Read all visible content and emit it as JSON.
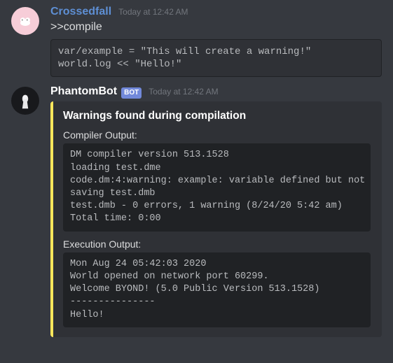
{
  "messages": [
    {
      "author": "Crossedfall",
      "author_color": "blue",
      "is_bot": false,
      "timestamp": "Today at 12:42 AM",
      "content": ">>compile",
      "code": "var/example = \"This will create a warning!\"\nworld.log << \"Hello!\""
    },
    {
      "author": "PhantomBot",
      "author_color": "white",
      "is_bot": true,
      "bot_label": "BOT",
      "timestamp": "Today at 12:42 AM",
      "embed": {
        "accent_color": "#ffe75c",
        "title": "Warnings found during compilation",
        "fields": [
          {
            "name": "Compiler Output:",
            "value": "DM compiler version 513.1528\nloading test.dme\ncode.dm:4:warning: example: variable defined but not used\nsaving test.dmb\ntest.dmb - 0 errors, 1 warning (8/24/20 5:42 am)\nTotal time: 0:00"
          },
          {
            "name": "Execution Output:",
            "value": "Mon Aug 24 05:42:03 2020\nWorld opened on network port 60299.\nWelcome BYOND! (5.0 Public Version 513.1528)\n---------------\nHello!"
          }
        ]
      }
    }
  ]
}
